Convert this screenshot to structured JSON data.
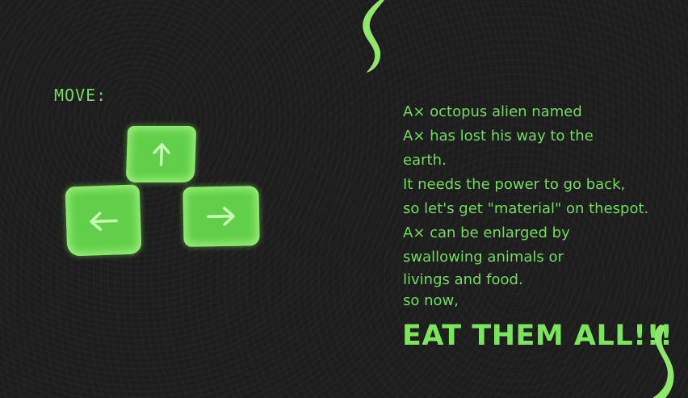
{
  "colors": {
    "background": "#1d1d1d",
    "accent_green": "#6fdc5a",
    "key_green": "#62cf4a",
    "key_glow": "#9bf07c",
    "tentacle_green": "#8fe86a"
  },
  "controls": {
    "title": "MOVE:",
    "keys": [
      {
        "direction": "up",
        "icon": "arrow-up-icon"
      },
      {
        "direction": "left",
        "icon": "arrow-left-icon"
      },
      {
        "direction": "right",
        "icon": "arrow-right-icon"
      }
    ]
  },
  "story": {
    "lines": [
      "A× octopus alien named",
      "A× has lost his way to the",
      "earth.",
      "It needs the power to go back,",
      "so let's get \"material\" on thespot.",
      "A× can be enlarged by",
      "swallowing animals or",
      "livings and food.",
      "so now,"
    ],
    "shout": "EAT THEM ALL!!!"
  },
  "decorations": [
    "tentacle-top",
    "tentacle-bottom"
  ]
}
